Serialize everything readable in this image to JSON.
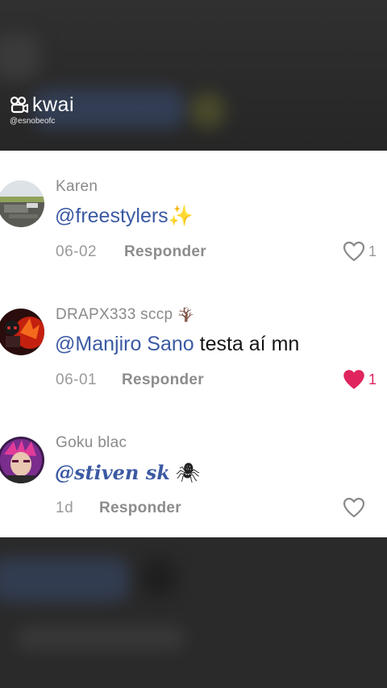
{
  "overlay": {
    "app_name": "kwai",
    "handle": "@esnobeofc"
  },
  "comments": [
    {
      "username": "Karen",
      "mention": "@freestylers",
      "emoji": "✨",
      "rest": "",
      "date": "06-02",
      "reply_label": "Responder",
      "likes": "1",
      "liked": false
    },
    {
      "username": "DRAPX333 sccp",
      "username_emoji": "🪾",
      "mention": "@Manjiro Sano",
      "emoji": "",
      "rest": " testa aí mn",
      "date": "06-01",
      "reply_label": "Responder",
      "likes": "1",
      "liked": true
    },
    {
      "username": "Goku blac",
      "mention": "@stiven sk",
      "emoji": "🕷",
      "rest": "",
      "date": "1d",
      "reply_label": "Responder",
      "likes": "",
      "liked": false
    }
  ],
  "colors": {
    "mention": "#3b5aa3",
    "liked_heart": "#e0245e"
  }
}
